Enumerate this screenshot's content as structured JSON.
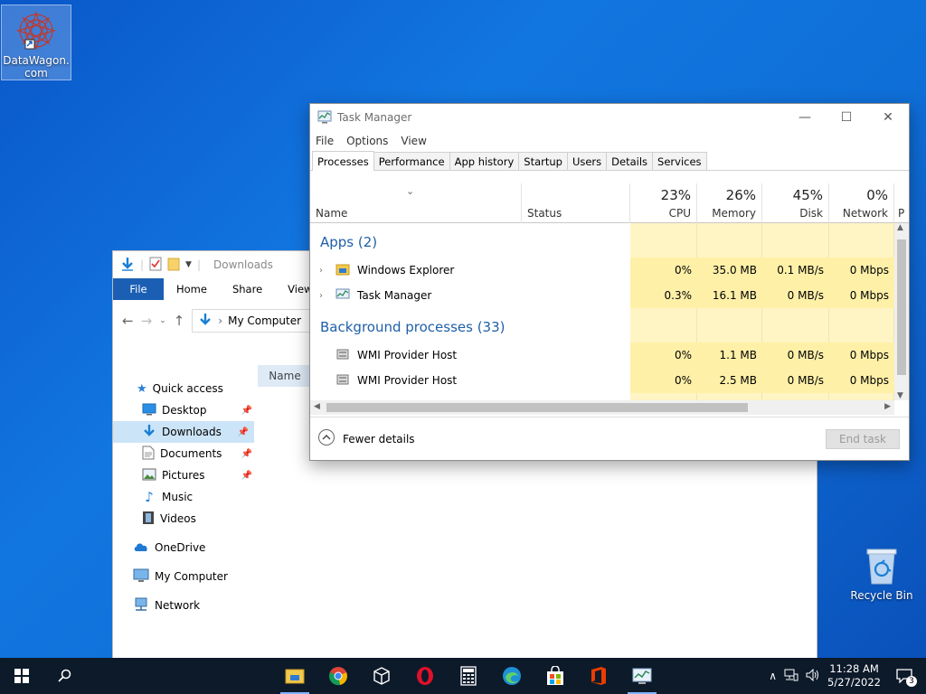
{
  "desktop": {
    "icons": [
      {
        "label": "DataWagon.com"
      },
      {
        "label": "Recycle Bin"
      }
    ]
  },
  "explorer": {
    "title": "Downloads",
    "ribbon_tabs": [
      "File",
      "Home",
      "Share",
      "View"
    ],
    "address": "My Computer",
    "column_header": "Name",
    "nav": {
      "quick_access": "Quick access",
      "items": [
        {
          "label": "Desktop",
          "pinned": true
        },
        {
          "label": "Downloads",
          "pinned": true
        },
        {
          "label": "Documents",
          "pinned": true
        },
        {
          "label": "Pictures",
          "pinned": true
        },
        {
          "label": "Music",
          "pinned": false
        },
        {
          "label": "Videos",
          "pinned": false
        }
      ],
      "onedrive": "OneDrive",
      "my_computer": "My Computer",
      "network": "Network"
    }
  },
  "taskmgr": {
    "title": "Task Manager",
    "menu": [
      "File",
      "Options",
      "View"
    ],
    "tabs": [
      "Processes",
      "Performance",
      "App history",
      "Startup",
      "Users",
      "Details",
      "Services"
    ],
    "columns": {
      "name": "Name",
      "status": "Status",
      "cpu": {
        "pct": "23%",
        "label": "CPU"
      },
      "memory": {
        "pct": "26%",
        "label": "Memory"
      },
      "disk": {
        "pct": "45%",
        "label": "Disk"
      },
      "network": {
        "pct": "0%",
        "label": "Network"
      },
      "extra": "P"
    },
    "groups": {
      "apps": "Apps (2)",
      "background": "Background processes (33)"
    },
    "rows": [
      {
        "name": "Windows Explorer",
        "cpu": "0%",
        "memory": "35.0 MB",
        "disk": "0.1 MB/s",
        "network": "0 Mbps"
      },
      {
        "name": "Task Manager",
        "cpu": "0.3%",
        "memory": "16.1 MB",
        "disk": "0 MB/s",
        "network": "0 Mbps"
      },
      {
        "name": "WMI Provider Host",
        "cpu": "0%",
        "memory": "1.1 MB",
        "disk": "0 MB/s",
        "network": "0 Mbps"
      },
      {
        "name": "WMI Provider Host",
        "cpu": "0%",
        "memory": "2.5 MB",
        "disk": "0 MB/s",
        "network": "0 Mbps"
      }
    ],
    "fewer_details": "Fewer details",
    "end_task": "End task"
  },
  "taskbar": {
    "time": "11:28 AM",
    "date": "5/27/2022",
    "notifications": "3"
  }
}
